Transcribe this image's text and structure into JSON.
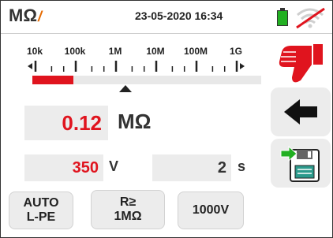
{
  "header": {
    "mode_label": "MΩ",
    "mode_bolt": "/",
    "datetime": "23-05-2020 16:34"
  },
  "scale": {
    "labels": [
      "10k",
      "100k",
      "1M",
      "10M",
      "100M",
      "1G"
    ],
    "bar_fraction": 0.18
  },
  "measurement": {
    "value": "0.12",
    "unit": "MΩ"
  },
  "voltage": {
    "value": "350",
    "unit": "V"
  },
  "time": {
    "value": "2",
    "unit": "s"
  },
  "buttons": {
    "auto": {
      "line1": "AUTO",
      "line2": "L-PE"
    },
    "threshold": {
      "line1": "R≥",
      "line2": "1MΩ"
    },
    "test_voltage": "1000V"
  },
  "icons": {
    "result": "thumbs-down-icon",
    "back": "arrow-left-icon",
    "save": "save-to-disk-icon",
    "battery": "battery-icon",
    "wifi": "wifi-disabled-icon"
  },
  "colors": {
    "accent_red": "#e0141e",
    "battery_green": "#22b022",
    "mode_bolt_orange": "#e56a00"
  }
}
